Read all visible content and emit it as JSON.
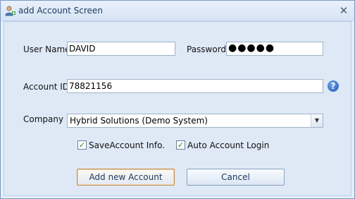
{
  "window": {
    "title": "add Account Screen",
    "close_glyph": "✕",
    "app_icon": "user-add-icon"
  },
  "form": {
    "username_label": "User Name",
    "username_value": "DAVID",
    "password_label": "Password",
    "password_value": "●●●●●",
    "account_id_label": "Account ID",
    "account_id_value": "78821156",
    "help_glyph": "?",
    "company_label": "Company",
    "company_value": "Hybrid Solutions (Demo System)",
    "combo_arrow": "▼"
  },
  "options": {
    "save_account_label": "SaveAccount Info.",
    "save_account_checked": true,
    "auto_login_label": "Auto Account Login",
    "auto_login_checked": true,
    "check_glyph": "✓"
  },
  "buttons": {
    "add_label": "Add new Account",
    "cancel_label": "Cancel"
  },
  "colors": {
    "accent": "#1f5bb8",
    "check": "#2a8a2a",
    "default_button_border": "#c08a4a"
  }
}
